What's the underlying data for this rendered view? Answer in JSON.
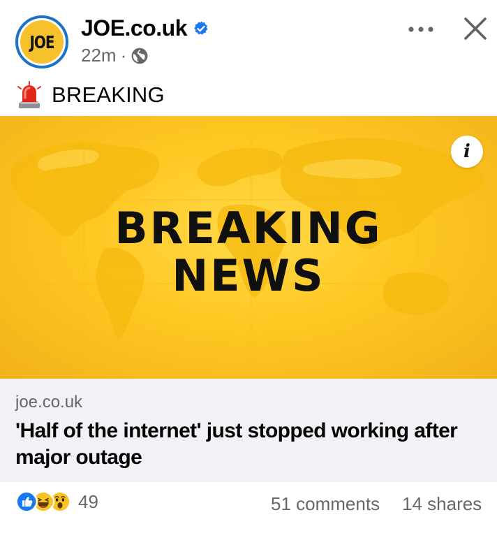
{
  "post": {
    "avatar_text": "JOE",
    "page_name": "JOE.co.uk",
    "timestamp": "22m",
    "meta_separator": "·",
    "caption": "BREAKING",
    "hero_line1": "BREAKING",
    "hero_line2": "NEWS",
    "info_glyph": "i",
    "link_domain": "joe.co.uk",
    "link_title": "'Half of the internet' just stopped working after major outage",
    "reaction_count": "49",
    "comments": "51 comments",
    "shares": "14 shares"
  },
  "icons": {
    "verified": "verified-badge-icon",
    "audience": "globe-icon",
    "more": "more-options-icon",
    "close": "close-icon",
    "caption_emoji": "police-light-icon",
    "info": "info-icon",
    "reactions": [
      "like-icon",
      "haha-icon",
      "wow-icon"
    ]
  },
  "colors": {
    "brand_blue": "#1e73c8",
    "joe_yellow": "#f6c12a",
    "hero_yellow": "#ffc822",
    "like_blue": "#1877f2",
    "link_bg": "#f0f2f5",
    "secondary_text": "#65676b"
  }
}
